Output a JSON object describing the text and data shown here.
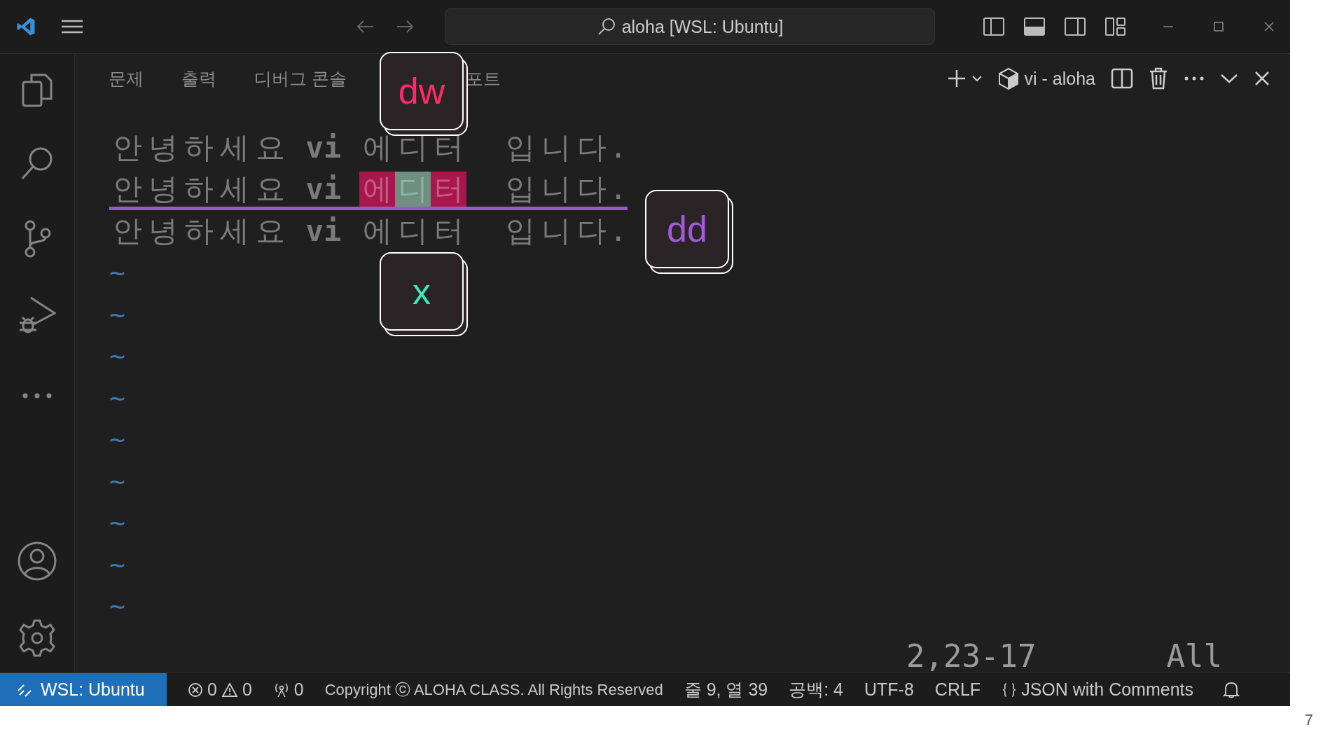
{
  "title_bar": {
    "search": "aloha [WSL: Ubuntu]"
  },
  "panel": {
    "tabs": [
      "문제",
      "출력",
      "디버그 콘솔",
      "포트"
    ],
    "terminal_name": "vi - aloha"
  },
  "editor": {
    "lines": [
      {
        "underline": false,
        "segments": [
          {
            "text": "안녕하세요 ",
            "kind": "plain"
          },
          {
            "text": "vi",
            "kind": "bold"
          },
          {
            "text": " 에디터  입니다.",
            "kind": "plain"
          }
        ]
      },
      {
        "underline": true,
        "segments": [
          {
            "text": "안녕하세요 ",
            "kind": "plain"
          },
          {
            "text": "vi ",
            "kind": "bold"
          },
          {
            "text": "에",
            "kind": "marked"
          },
          {
            "text": "디",
            "kind": "cursor"
          },
          {
            "text": "터",
            "kind": "marked"
          },
          {
            "text": "  입니다.",
            "kind": "plain"
          }
        ]
      },
      {
        "underline": false,
        "segments": [
          {
            "text": "안녕하세요 ",
            "kind": "plain"
          },
          {
            "text": "vi",
            "kind": "bold"
          },
          {
            "text": " 에디터  입니다.",
            "kind": "plain"
          }
        ]
      }
    ],
    "empty_lines": [
      "~",
      "~",
      "~",
      "~",
      "~",
      "~",
      "~",
      "~",
      "~"
    ],
    "position": "2,23-17",
    "scroll": "All"
  },
  "keys": [
    {
      "label": "dw",
      "color": "#ff2a6a"
    },
    {
      "label": "dd",
      "color": "#a25ad8"
    },
    {
      "label": "x",
      "color": "#3ee8b5"
    }
  ],
  "status_bar": {
    "remote": "WSL: Ubuntu",
    "errors": "0",
    "warnings": "0",
    "ports": "0",
    "copyright": "Copyright ⓒ ALOHA CLASS. All Rights Reserved",
    "cursor": "줄 9, 열 39",
    "spaces": "공백: 4",
    "encoding": "UTF-8",
    "eol": "CRLF",
    "language": "JSON with Comments"
  },
  "page_number": "7"
}
